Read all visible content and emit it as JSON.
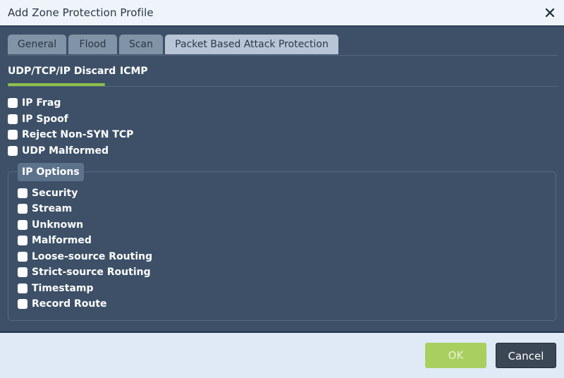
{
  "dialog": {
    "title": "Add Zone Protection Profile",
    "close_icon": "close-icon"
  },
  "tabs": [
    {
      "label": "General",
      "active": false
    },
    {
      "label": "Flood",
      "active": false
    },
    {
      "label": "Scan",
      "active": false
    },
    {
      "label": "Packet Based Attack Protection",
      "active": true
    }
  ],
  "subtabs": [
    {
      "label": "UDP/TCP/IP Discard",
      "active": true
    },
    {
      "label": "ICMP",
      "active": false
    }
  ],
  "discard_options": [
    {
      "label": "IP Frag",
      "checked": false
    },
    {
      "label": "IP Spoof",
      "checked": false
    },
    {
      "label": "Reject Non-SYN TCP",
      "checked": false
    },
    {
      "label": "UDP Malformed",
      "checked": false
    }
  ],
  "ip_options": {
    "legend": "IP Options",
    "items": [
      {
        "label": "Security",
        "checked": false
      },
      {
        "label": "Stream",
        "checked": false
      },
      {
        "label": "Unknown",
        "checked": false
      },
      {
        "label": "Malformed",
        "checked": false
      },
      {
        "label": "Loose-source Routing",
        "checked": false
      },
      {
        "label": "Strict-source Routing",
        "checked": false
      },
      {
        "label": "Timestamp",
        "checked": false
      },
      {
        "label": "Record Route",
        "checked": false
      }
    ]
  },
  "footer": {
    "ok_label": "OK",
    "cancel_label": "Cancel"
  },
  "colors": {
    "accent": "#8ec04a",
    "ok_button": "#a9cf5e",
    "panel": "#3d5067"
  }
}
